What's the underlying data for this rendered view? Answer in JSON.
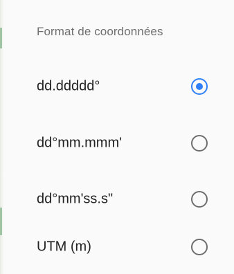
{
  "dialog": {
    "title": "Format de coordonnées",
    "selected_index": 0,
    "accent_color": "#2f80f6",
    "options": [
      {
        "label": "dd.ddddd°",
        "selected": true
      },
      {
        "label": "dd°mm.mmm'",
        "selected": false
      },
      {
        "label": "dd°mm'ss.s\"",
        "selected": false
      },
      {
        "label": "UTM (m)",
        "selected": false
      }
    ]
  }
}
